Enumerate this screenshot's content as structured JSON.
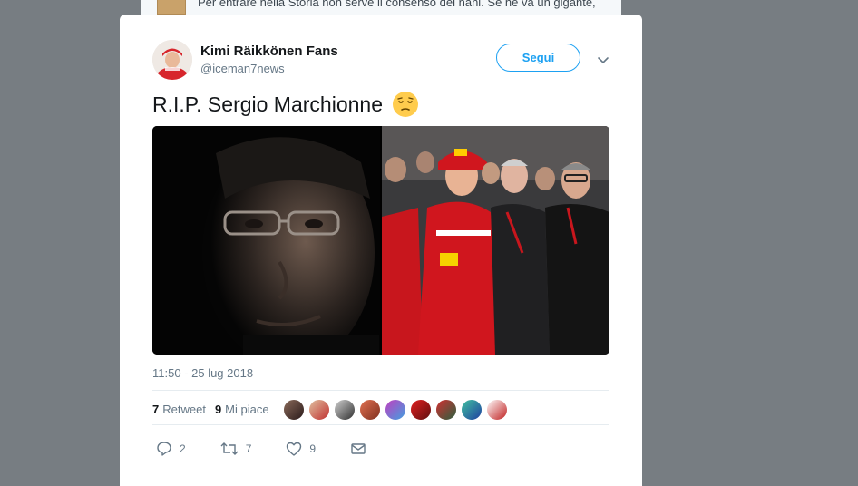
{
  "background": {
    "tweet_snippet": "Per entrare nella Storia non serve il consenso dei nani. Se ne va un gigante,"
  },
  "tweet": {
    "author_name": "Kimi Räikkönen Fans",
    "author_handle": "@iceman7news",
    "follow_label": "Segui",
    "text": "R.I.P. Sergio Marchionne",
    "emoji": "pensive-face-emoji",
    "timestamp": "11:50 - 25 lug 2018",
    "retweet_count": "7",
    "retweet_label": "Retweet",
    "like_count": "9",
    "like_label": "Mi piace",
    "likers_visible": 9,
    "actions": {
      "reply_count": "2",
      "retweet_count": "7",
      "like_count": "9"
    }
  },
  "icons": {
    "reply": "reply-icon",
    "retweet": "retweet-icon",
    "like": "heart-icon",
    "dm": "envelope-icon",
    "more": "chevron-down-icon"
  },
  "colors": {
    "accent": "#1da1f2",
    "text": "#14171a",
    "muted": "#657786",
    "backdrop": "#777d82"
  }
}
